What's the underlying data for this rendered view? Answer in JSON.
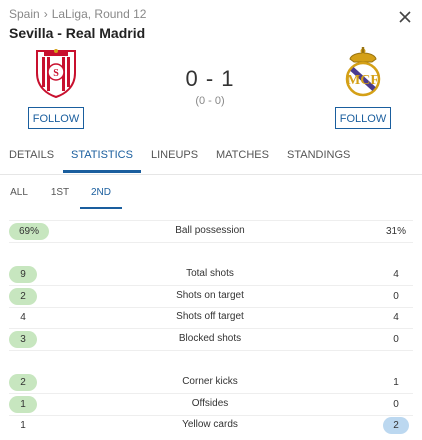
{
  "header": {
    "country": "Spain",
    "separator": "›",
    "competition": "LaLiga, Round 12",
    "title": "Sevilla - Real Madrid",
    "close_icon": "close-icon"
  },
  "home": {
    "name": "Sevilla",
    "follow_label": "FOLLOW",
    "logo_icon": "sevilla-crest-icon"
  },
  "away": {
    "name": "Real Madrid",
    "follow_label": "FOLLOW",
    "logo_icon": "real-madrid-crest-icon"
  },
  "score": {
    "main": "0 - 1",
    "halftime": "(0 - 0)"
  },
  "tabs": [
    {
      "label": "DETAILS"
    },
    {
      "label": "STATISTICS"
    },
    {
      "label": "LINEUPS"
    },
    {
      "label": "MATCHES"
    },
    {
      "label": "STANDINGS"
    }
  ],
  "subtabs": [
    {
      "label": "ALL"
    },
    {
      "label": "1ST"
    },
    {
      "label": "2ND"
    }
  ],
  "stats": [
    {
      "label": "Ball possession",
      "home": "69%",
      "away": "31%",
      "highlight": "home"
    },
    {
      "label": "Total shots",
      "home": "9",
      "away": "4",
      "highlight": "home"
    },
    {
      "label": "Shots on target",
      "home": "2",
      "away": "0",
      "highlight": "home"
    },
    {
      "label": "Shots off target",
      "home": "4",
      "away": "4",
      "highlight": "none"
    },
    {
      "label": "Blocked shots",
      "home": "3",
      "away": "0",
      "highlight": "home"
    },
    {
      "label": "Corner kicks",
      "home": "2",
      "away": "1",
      "highlight": "home"
    },
    {
      "label": "Offsides",
      "home": "1",
      "away": "0",
      "highlight": "home"
    },
    {
      "label": "Yellow cards",
      "home": "1",
      "away": "2",
      "highlight": "away"
    }
  ],
  "colors": {
    "accent": "#1a5e9e",
    "home_pill": "#c7e6bf",
    "away_pill": "#bcd8f0"
  }
}
